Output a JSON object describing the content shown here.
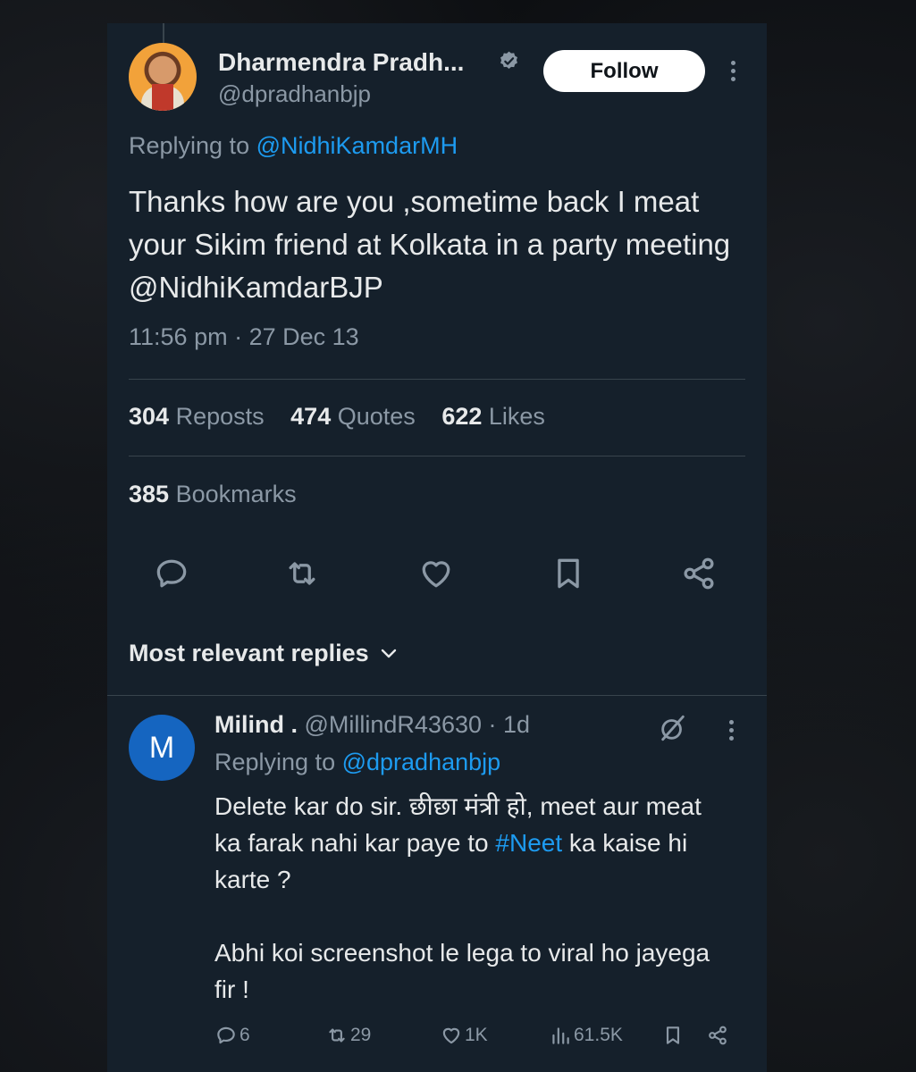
{
  "tweet": {
    "author_name": "Dharmendra Pradh...",
    "handle": "@dpradhanbjp",
    "follow_label": "Follow",
    "replying_prefix": "Replying to",
    "replying_to": "@NidhiKamdarMH",
    "text": "Thanks how are you ,sometime back I meat your Sikim friend at Kolkata in a party meeting @NidhiKamdarBJP",
    "timestamp": "11:56 pm · 27 Dec 13",
    "stats": {
      "reposts_count": "304",
      "reposts_label": "Reposts",
      "quotes_count": "474",
      "quotes_label": "Quotes",
      "likes_count": "622",
      "likes_label": "Likes",
      "bookmarks_count": "385",
      "bookmarks_label": "Bookmarks"
    },
    "icons": {
      "verified": "verified-badge-icon",
      "more": "more-icon",
      "reply": "reply-icon",
      "repost": "repost-icon",
      "like": "heart-icon",
      "bookmark": "bookmark-icon",
      "share": "share-icon"
    }
  },
  "replies_section": {
    "sort_label": "Most relevant replies"
  },
  "reply": {
    "avatar_letter": "M",
    "name": "Milind .",
    "handle": "@MillindR43630",
    "time": "· 1d",
    "replying_prefix": "Replying to",
    "replying_to": "@dpradhanbjp",
    "text_part1": "Delete kar do sir. छीछा मंत्री हो, meet aur meat ka farak nahi kar paye to ",
    "hashtag": "#Neet",
    "text_part2": " ka kaise hi karte ?\n\nAbhi koi screenshot le lega to viral ho jayega fir !",
    "actions": {
      "replies": "6",
      "reposts": "29",
      "likes": "1K",
      "views": "61.5K"
    }
  },
  "colors": {
    "background": "#15202b",
    "accent": "#1d9bf0",
    "text_primary": "#e7e9ea",
    "text_secondary": "#8b98a5",
    "divider": "#38444d",
    "reply_avatar": "#1565c0"
  }
}
